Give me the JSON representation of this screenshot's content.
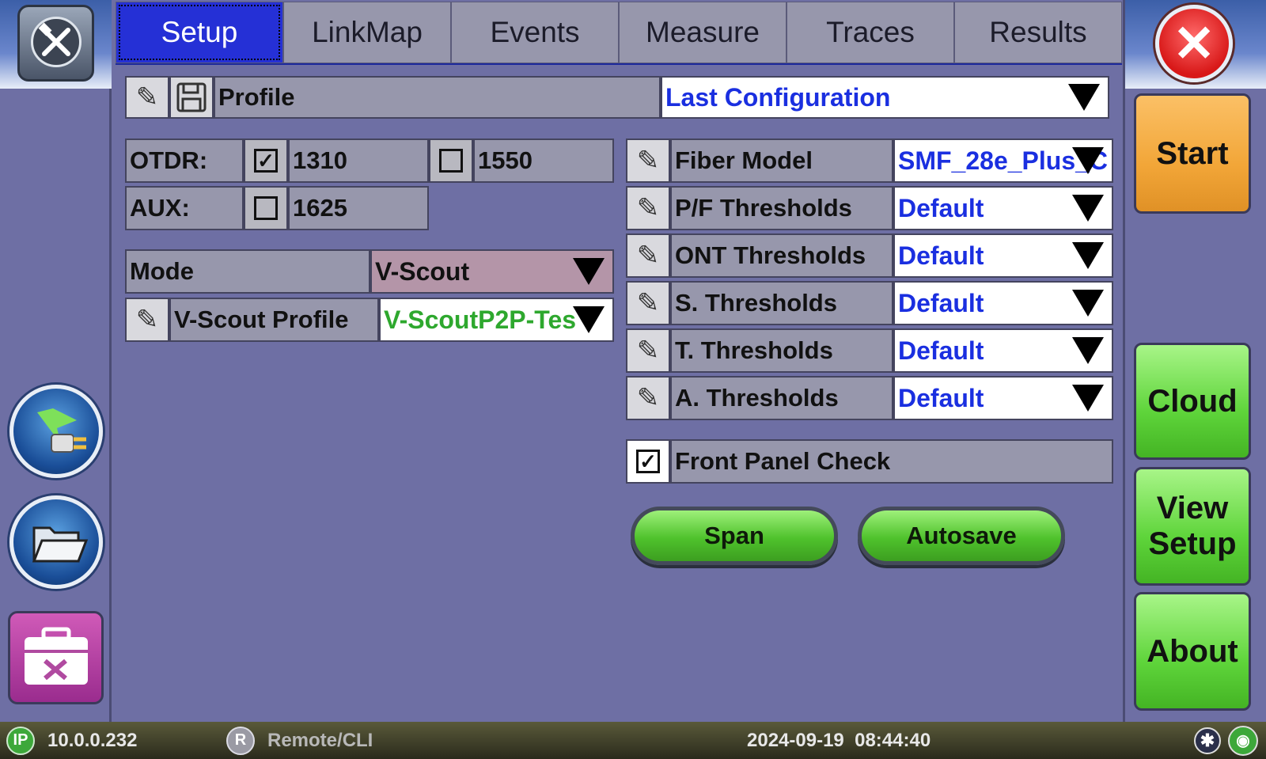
{
  "tabs": [
    "Setup",
    "LinkMap",
    "Events",
    "Measure",
    "Traces",
    "Results"
  ],
  "profile": {
    "label": "Profile",
    "value": "Last Configuration"
  },
  "otdr": {
    "label": "OTDR:",
    "wl1": "1310",
    "wl1_checked": true,
    "wl2": "1550",
    "wl2_checked": false
  },
  "aux": {
    "label": "AUX:",
    "wl": "1625",
    "checked": false
  },
  "mode": {
    "label": "Mode",
    "value": "V-Scout"
  },
  "vscout": {
    "label": "V-Scout Profile",
    "value": "V-ScoutP2P-Tes"
  },
  "right_rows": [
    {
      "label": "Fiber Model",
      "value": "SMF_28e_Plus_C"
    },
    {
      "label": "P/F Thresholds",
      "value": "Default"
    },
    {
      "label": "ONT Thresholds",
      "value": "Default"
    },
    {
      "label": "S. Thresholds",
      "value": "Default"
    },
    {
      "label": "T. Thresholds",
      "value": "Default"
    },
    {
      "label": "A. Thresholds",
      "value": "Default"
    }
  ],
  "front_panel": {
    "label": "Front Panel Check",
    "checked": true
  },
  "buttons": {
    "span": "Span",
    "autosave": "Autosave"
  },
  "side_buttons": {
    "start": "Start",
    "cloud": "Cloud",
    "view_setup": "View Setup",
    "about": "About"
  },
  "status": {
    "ip_badge": "IP",
    "ip": "10.0.0.232",
    "r_badge": "R",
    "remote": "Remote/CLI",
    "datetime": "2024-09-19  08:44:40"
  },
  "colors": {
    "background": "#6e6fa4",
    "active_tab": "#2530d6",
    "dropdown_text": "#1a2fe0",
    "vscout_text": "#2ea82e",
    "mode_bg": "#b495a8"
  }
}
